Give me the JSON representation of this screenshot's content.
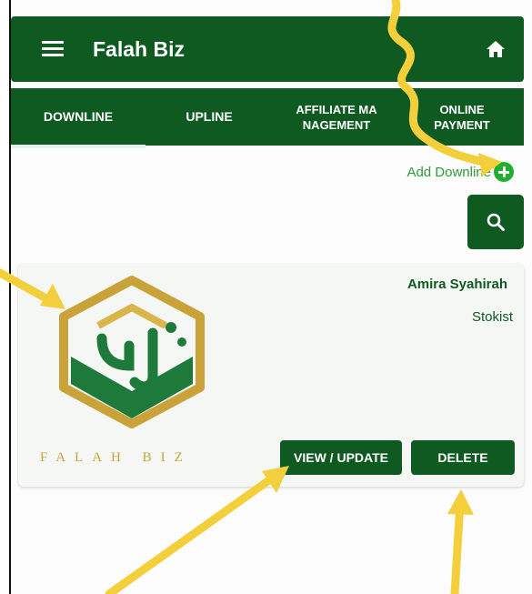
{
  "app": {
    "title": "Falah Biz"
  },
  "tabs": [
    {
      "label": "DOWNLINE",
      "active": true
    },
    {
      "label": "UPLINE",
      "active": false
    },
    {
      "label": "AFFILIATE MA\nNAGEMENT",
      "active": false
    },
    {
      "label": "ONLINE\nPAYMENT",
      "active": false
    }
  ],
  "actions": {
    "add_downline_label": "Add Downline"
  },
  "member": {
    "name": "Amira Syahirah",
    "role": "Stokist",
    "logo_text": "FALAH BIZ",
    "view_label": "VIEW / UPDATE",
    "delete_label": "DELETE"
  },
  "icons": {
    "menu": "menu-icon",
    "home": "home-icon",
    "add": "plus-circle-icon",
    "search": "search-icon"
  },
  "colors": {
    "primary": "#0f5a21",
    "add_accent": "#1fae2e",
    "logo_gold": "#c9a33a",
    "annotation_arrow": "#f2cf3b"
  }
}
